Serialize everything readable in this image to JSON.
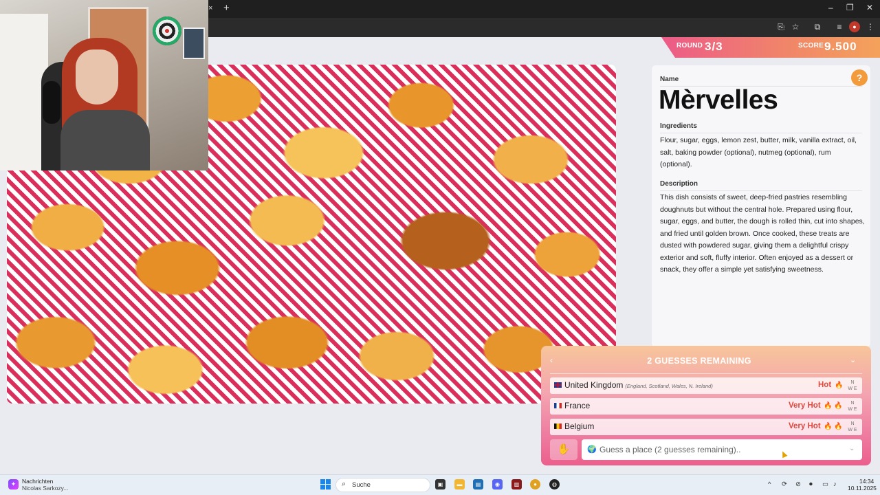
{
  "browser": {
    "tab_close": "×",
    "new_tab": "+",
    "minimize": "–",
    "maximize": "❐",
    "close": "✕"
  },
  "game": {
    "round_label": "ROUND",
    "round_value": "3/3",
    "score_label": "SCORE",
    "score_value": "9.500"
  },
  "dish": {
    "name_label": "Name",
    "name": "Mèrvelles",
    "ingredients_label": "Ingredients",
    "ingredients": "Flour, sugar, eggs, lemon zest, butter, milk, vanilla extract, oil, salt, baking powder (optional), nutmeg (optional), rum (optional).",
    "description_label": "Description",
    "description": "This dish consists of sweet, deep-fried pastries resembling doughnuts but without the central hole. Prepared using flour, sugar, eggs, and butter, the dough is rolled thin, cut into shapes, and fried until golden brown. Once cooked, these treats are dusted with powdered sugar, giving them a delightful crispy exterior and soft, fluffy interior. Often enjoyed as a dessert or snack, they offer a simple yet satisfying sweetness.",
    "help_symbol": "?"
  },
  "guesses": {
    "title": "2 GUESSES REMAINING",
    "back_symbol": "‹",
    "collapse_symbol": "⌄",
    "items": [
      {
        "country": "United Kingdom",
        "sub": "(England, Scotland, Wales, N. Ireland)",
        "heat": "Hot",
        "flames": "🔥",
        "dir": "N\nW E"
      },
      {
        "country": "France",
        "sub": "",
        "heat": "Very Hot",
        "flames": "🔥 🔥",
        "dir": "N\nW E"
      },
      {
        "country": "Belgium",
        "sub": "",
        "heat": "Very Hot",
        "flames": "🔥 🔥",
        "dir": "N\nW E"
      }
    ],
    "input_placeholder": "Guess a place (2 guesses remaining)..",
    "input_icon": "🌍",
    "dropdown_symbol": "⌄",
    "submit_symbol": "✋"
  },
  "taskbar": {
    "news_title": "Nachrichten",
    "news_sub": "Nicolas Sarkozy...",
    "search_label": "Suche",
    "time": "14:34",
    "date": "10.11.2025"
  },
  "colors": {
    "accent_pink": "#ec5a88",
    "accent_orange": "#f4a25b",
    "heat_red": "#e0483c"
  }
}
